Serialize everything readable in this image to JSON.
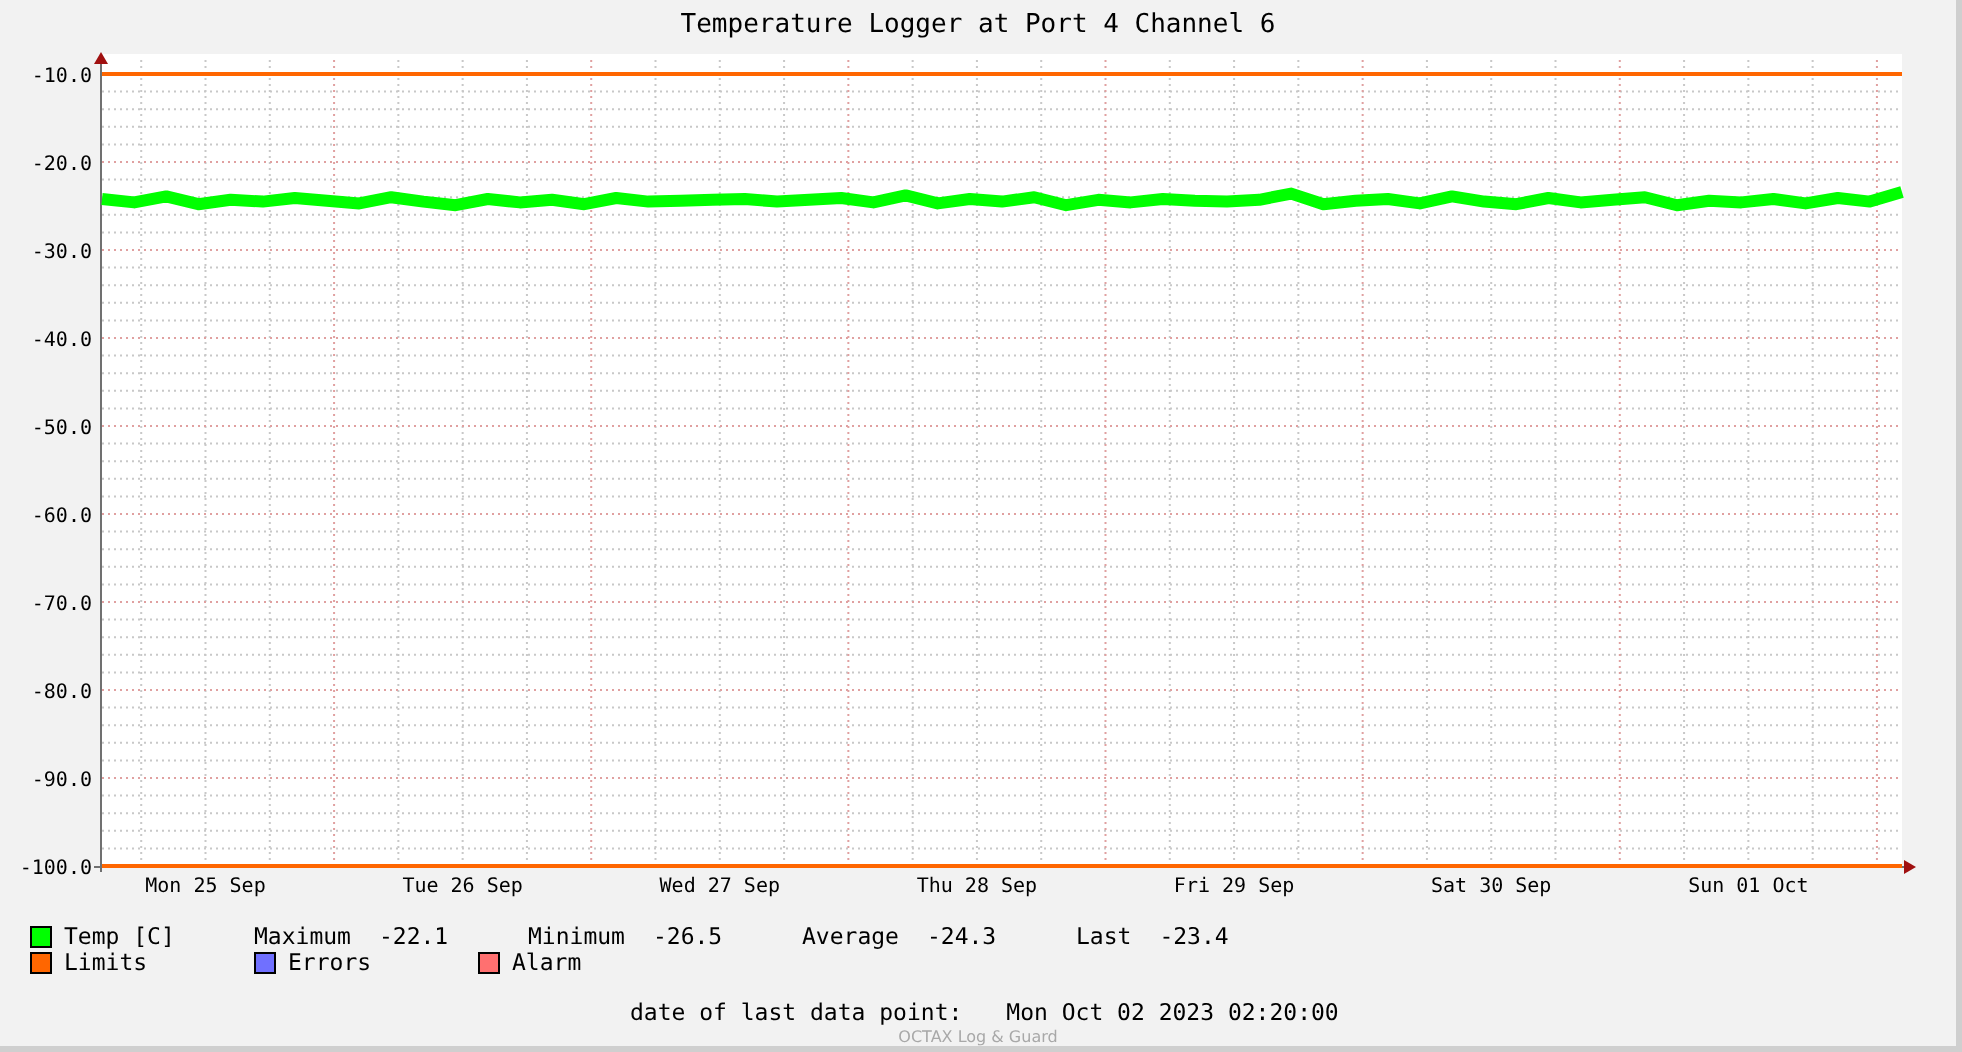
{
  "graph": {
    "chart_data": {
      "type": "line",
      "title": "Temperature Logger at Port 4 Channel 6",
      "categories": [
        null,
        null,
        null,
        "Mon 25 Sep",
        null,
        null,
        null,
        null,
        null,
        null,
        null,
        "Tue 26 Sep",
        null,
        null,
        null,
        null,
        null,
        null,
        null,
        "Wed 27 Sep",
        null,
        null,
        null,
        null,
        null,
        null,
        null,
        "Thu 28 Sep",
        null,
        null,
        null,
        null,
        null,
        null,
        null,
        "Fri 29 Sep",
        null,
        null,
        null,
        null,
        null,
        null,
        null,
        "Sat 30 Sep",
        null,
        null,
        null,
        null,
        null,
        null,
        null,
        "Sun 01 Oct",
        null,
        null,
        null,
        null,
        null
      ],
      "series": [
        {
          "name": "Temp [C]",
          "color": "#00ff00",
          "values": [
            -24.2,
            -24.6,
            -23.9,
            -24.8,
            -24.3,
            -24.5,
            -24.1,
            -24.4,
            -24.7,
            -24.0,
            -24.5,
            -24.9,
            -24.2,
            -24.6,
            -24.3,
            -24.8,
            -24.1,
            -24.5,
            -24.4,
            -24.3,
            -24.2,
            -24.5,
            -24.3,
            -24.1,
            -24.6,
            -23.8,
            -24.7,
            -24.2,
            -24.5,
            -24.0,
            -24.9,
            -24.3,
            -24.6,
            -24.2,
            -24.4,
            -24.5,
            -24.3,
            -23.6,
            -24.8,
            -24.4,
            -24.2,
            -24.7,
            -23.9,
            -24.5,
            -24.8,
            -24.1,
            -24.6,
            -24.3,
            -24.0,
            -24.9,
            -24.4,
            -24.6,
            -24.2,
            -24.7,
            -24.1,
            -24.5,
            -23.4
          ]
        }
      ],
      "ylim": [
        -100,
        -10
      ],
      "grid": true,
      "yticks": [
        {
          "value": -10,
          "label": "-10.0"
        },
        {
          "value": -20,
          "label": "-20.0"
        },
        {
          "value": -30,
          "label": "-30.0"
        },
        {
          "value": -40,
          "label": "-40.0"
        },
        {
          "value": -50,
          "label": "-50.0"
        },
        {
          "value": -60,
          "label": "-60.0"
        },
        {
          "value": -70,
          "label": "-70.0"
        },
        {
          "value": -80,
          "label": "-80.0"
        },
        {
          "value": -90,
          "label": "-90.0"
        },
        {
          "value": -100,
          "label": "-100.0"
        }
      ]
    }
  },
  "legend": {
    "entries": [
      {
        "kind": "limits",
        "label": "Limits",
        "color": "#ff6600"
      },
      {
        "kind": "errors",
        "label": "Errors",
        "color": "#7070ff"
      },
      {
        "kind": "alarm",
        "label": "Alarm",
        "color": "#ff7070"
      }
    ],
    "stats": [
      {
        "label": "Maximum",
        "value": "-22.1"
      },
      {
        "label": "Minimum",
        "value": "-26.5"
      },
      {
        "label": "Average",
        "value": "-24.3"
      },
      {
        "label": "Last",
        "value": "-23.4"
      }
    ]
  },
  "footer": {
    "label": "date of last data point:",
    "value": "Mon Oct 02 2023 02:20:00",
    "credit": "OCTAX Log & Guard"
  }
}
